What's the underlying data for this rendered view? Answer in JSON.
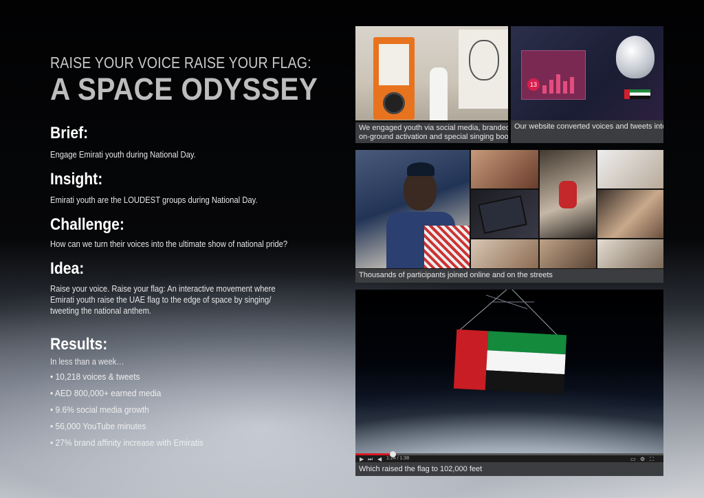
{
  "header": {
    "kicker": "RAISE YOUR VOICE RAISE YOUR FLAG:",
    "title": "A SPACE ODYSSEY"
  },
  "sections": {
    "brief": {
      "heading": "Brief:",
      "text": "Engage Emirati youth during National Day."
    },
    "insight": {
      "heading": "Insight:",
      "text": "Emirati youth are the LOUDEST groups during National Day."
    },
    "challenge": {
      "heading": "Challenge:",
      "text": "How can we turn their voices into the ultimate show of national pride?"
    },
    "idea": {
      "heading": "Idea:",
      "lines": [
        "Raise your voice. Raise your flag: An interactive movement where",
        "Emirati youth raise the UAE flag to the edge of space by singing/",
        "tweeting the national anthem."
      ]
    },
    "results": {
      "heading": "Results:",
      "intro": "In less than a week…",
      "bullets": [
        "• 10,218 voices & tweets",
        "• AED 800,000+ earned media",
        "• 9.6% social media growth",
        "• 56,000 YouTube minutes",
        "• 27% brand affinity increase with Emiratis"
      ]
    }
  },
  "panels": {
    "booth": {
      "caption_lines": [
        "We engaged youth via social media, branded trucks,",
        "on-ground activation and special singing booths"
      ]
    },
    "website": {
      "caption": "Our website converted voices and tweets into meters",
      "meter_value": "13"
    },
    "participants": {
      "caption": "Thousands of participants joined online and on the streets"
    },
    "video": {
      "caption": "Which raised the flag to 102,000 feet",
      "time": "1:24 / 1:38",
      "progress": 0.12
    }
  },
  "colors": {
    "flag_red": "#c81d24",
    "flag_green": "#138a3c",
    "flag_white": "#f5f5f5",
    "flag_black": "#141414",
    "caption_bg": "#3c3d40"
  },
  "icons": {
    "play": "play-icon",
    "volume": "volume-icon",
    "settings": "gear-icon",
    "fullscreen": "fullscreen-icon"
  }
}
